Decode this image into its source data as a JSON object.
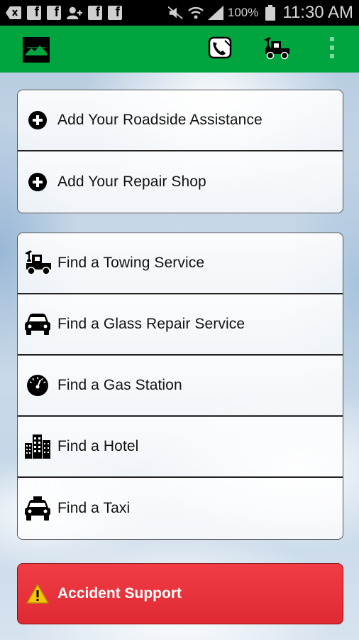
{
  "status_bar": {
    "battery": "100%",
    "time": "11:30 AM",
    "icons": [
      "back-icon",
      "facebook-icon",
      "facebook-icon",
      "add-person-icon",
      "facebook-icon",
      "facebook-icon",
      "mute-icon",
      "wifi-icon",
      "signal-icon",
      "battery-icon"
    ]
  },
  "app_bar": {
    "background_color": "#00a53f",
    "actions": [
      "call-icon",
      "tow-truck-icon",
      "overflow-menu-icon"
    ]
  },
  "add_section": {
    "items": [
      {
        "label": "Add Your Roadside Assistance",
        "icon": "plus-circle-icon"
      },
      {
        "label": "Add Your Repair Shop",
        "icon": "plus-circle-icon"
      }
    ]
  },
  "find_section": {
    "items": [
      {
        "label": "Find a Towing Service",
        "icon": "tow-truck-icon"
      },
      {
        "label": "Find a Glass Repair Service",
        "icon": "car-icon"
      },
      {
        "label": "Find a Gas Station",
        "icon": "gauge-icon"
      },
      {
        "label": "Find a Hotel",
        "icon": "buildings-icon"
      },
      {
        "label": "Find a Taxi",
        "icon": "taxi-icon"
      }
    ]
  },
  "accident": {
    "label": "Accident Support",
    "icon": "warning-icon",
    "color": "#e53039"
  }
}
